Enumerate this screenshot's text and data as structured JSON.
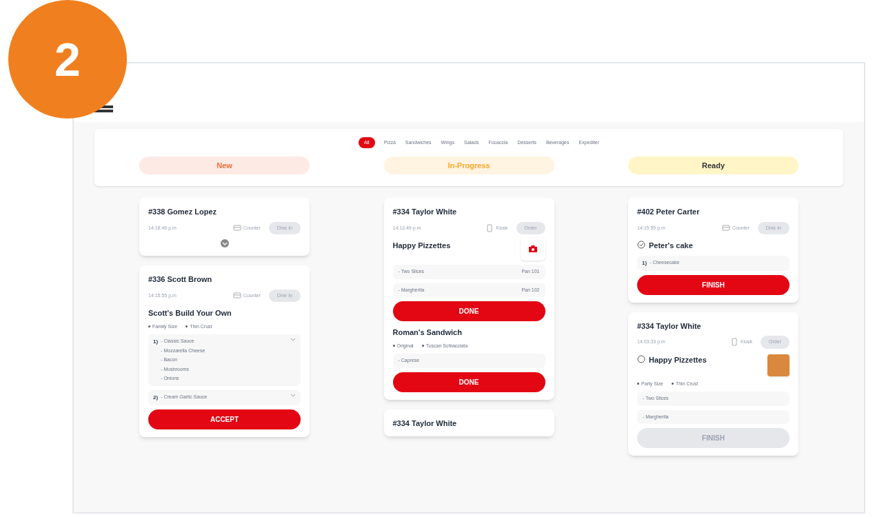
{
  "step_badge": "2",
  "filters": [
    {
      "label": "All",
      "selected": true
    },
    {
      "label": "Pizza",
      "selected": false
    },
    {
      "label": "Sandwiches",
      "selected": false
    },
    {
      "label": "Wings",
      "selected": false
    },
    {
      "label": "Salads",
      "selected": false
    },
    {
      "label": "Focaccia",
      "selected": false
    },
    {
      "label": "Desserts",
      "selected": false
    },
    {
      "label": "Beverages",
      "selected": false
    },
    {
      "label": "Expediter",
      "selected": false
    }
  ],
  "columns": [
    {
      "title": "New",
      "kind": "new",
      "cards": [
        {
          "title": "#338 Gomez Lopez",
          "time": "14:18:49 p.m",
          "kind": "counter",
          "channel": "Counter",
          "mode": "Dine In",
          "collapsed": true
        },
        {
          "title": "#336 Scott Brown",
          "time": "14:15:55 p.m",
          "kind": "counter",
          "channel": "Counter",
          "mode": "Dine In",
          "sections": [
            {
              "name": "Scott's Build Your Own",
              "options": [
                "Family Size",
                "Thin Crust"
              ],
              "groups": [
                {
                  "number": "1)",
                  "items": [
                    "- Classic Sauce",
                    "- Mozzarella Cheese",
                    "- Bacon",
                    "- Mushrooms",
                    "- Onions"
                  ],
                  "expandable": true
                },
                {
                  "number": "2)",
                  "items": [
                    "- Cream Garlic Sauce"
                  ],
                  "expandable": true
                }
              ],
              "button": {
                "label": "ACCEPT",
                "disabled": false
              }
            }
          ]
        }
      ]
    },
    {
      "title": "In-Progress",
      "kind": "progress",
      "cards": [
        {
          "title": "#334 Taylor White",
          "time": "14:13:49 p.m",
          "kind": "kiosk",
          "channel": "Kiosk",
          "mode": "Order",
          "sections": [
            {
              "name": "Happy Pizzettes",
              "picture": {
                "kind": "camera"
              },
              "lines": [
                {
                  "text": "- Two Slices",
                  "pan": "Pan 101"
                },
                {
                  "text": "- Margherita",
                  "pan": "Pan 102"
                }
              ],
              "button": {
                "label": "DONE",
                "disabled": false
              }
            },
            {
              "name": "Roman's Sandwich",
              "options": [
                "Original",
                "Tuscan Schiacciata"
              ],
              "lines": [
                {
                  "text": "- Caprese"
                }
              ],
              "button": {
                "label": "DONE",
                "disabled": false
              }
            }
          ]
        },
        {
          "title": "#334 Taylor White"
        }
      ]
    },
    {
      "title": "Ready",
      "kind": "ready",
      "cards": [
        {
          "title": "#402 Peter Carter",
          "time": "14:15:55 p.m",
          "kind": "counter",
          "channel": "Counter",
          "mode": "Dine In",
          "sections": [
            {
              "name": "Peter's cake",
              "checked": true,
              "groups": [
                {
                  "number": "1)",
                  "items": [
                    "- Cheesecake"
                  ],
                  "expandable": false
                }
              ],
              "button": {
                "label": "FINISH",
                "disabled": false
              }
            }
          ]
        },
        {
          "title": "#334 Taylor White",
          "time": "14:03:33 p.m",
          "kind": "kiosk",
          "channel": "Kiosk",
          "mode": "Order",
          "sections": [
            {
              "name": "Happy Pizzettes",
              "checked": false,
              "picture": {
                "kind": "photo"
              },
              "options": [
                "Party Size",
                "Thin Crust"
              ],
              "lines": [
                {
                  "text": "- Two Slices"
                },
                {
                  "text": "- Margherita"
                }
              ],
              "button": {
                "label": "FINISH",
                "disabled": true
              }
            }
          ]
        }
      ]
    }
  ]
}
